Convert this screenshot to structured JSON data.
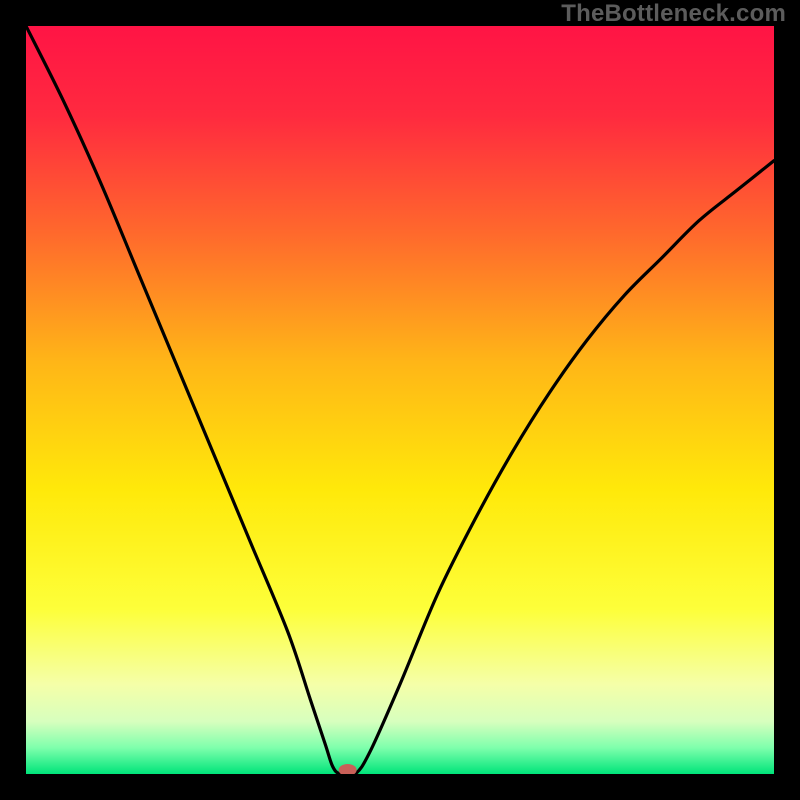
{
  "watermark": "TheBottleneck.com",
  "chart_data": {
    "type": "line",
    "title": "",
    "xlabel": "",
    "ylabel": "",
    "xlim": [
      0,
      100
    ],
    "ylim": [
      0,
      100
    ],
    "series": [
      {
        "name": "curve",
        "x": [
          0,
          5,
          10,
          15,
          20,
          25,
          30,
          35,
          38,
          40,
          41,
          42,
          44,
          46,
          50,
          55,
          60,
          65,
          70,
          75,
          80,
          85,
          90,
          95,
          100
        ],
        "values": [
          100,
          90,
          79,
          67,
          55,
          43,
          31,
          19,
          10,
          4,
          1,
          0,
          0,
          3,
          12,
          24,
          34,
          43,
          51,
          58,
          64,
          69,
          74,
          78,
          82
        ]
      }
    ],
    "marker": {
      "x": 43,
      "y": 0
    },
    "gradient_stops": [
      {
        "offset": 0.0,
        "color": "#ff1445"
      },
      {
        "offset": 0.12,
        "color": "#ff2a3f"
      },
      {
        "offset": 0.28,
        "color": "#ff6a2c"
      },
      {
        "offset": 0.45,
        "color": "#ffb617"
      },
      {
        "offset": 0.62,
        "color": "#ffe90a"
      },
      {
        "offset": 0.78,
        "color": "#fdff3a"
      },
      {
        "offset": 0.88,
        "color": "#f5ffa8"
      },
      {
        "offset": 0.93,
        "color": "#d7ffbe"
      },
      {
        "offset": 0.965,
        "color": "#7effac"
      },
      {
        "offset": 1.0,
        "color": "#00e47a"
      }
    ]
  }
}
